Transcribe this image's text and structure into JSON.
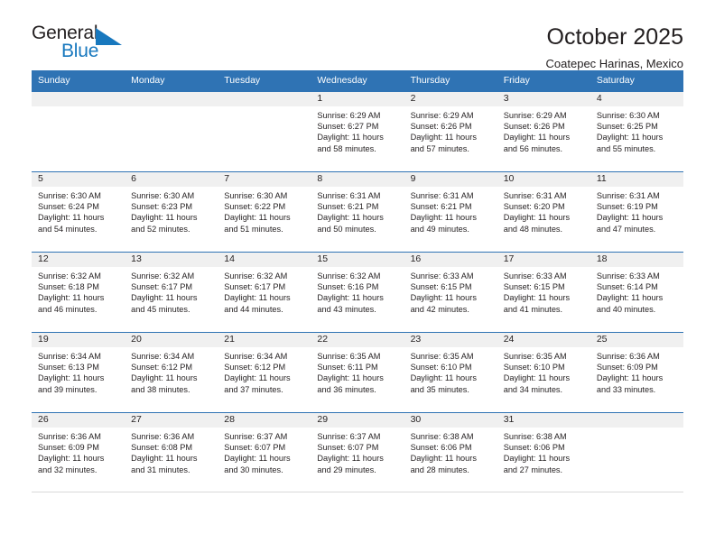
{
  "logo": {
    "word_top": "General",
    "word_bottom": "Blue",
    "accent_color": "#1878be",
    "triangle_icon": "triangle-icon"
  },
  "header": {
    "title": "October 2025",
    "subtitle": "Coatepec Harinas, Mexico"
  },
  "theme": {
    "header_blue": "#2f73b4",
    "day_band_gray": "#f0f0f0",
    "text_color": "#231f20"
  },
  "calendar": {
    "weekday_headers": [
      "Sunday",
      "Monday",
      "Tuesday",
      "Wednesday",
      "Thursday",
      "Friday",
      "Saturday"
    ],
    "labels": {
      "sunrise": "Sunrise:",
      "sunset": "Sunset:",
      "daylight": "Daylight:"
    },
    "weeks": [
      [
        {
          "day": "",
          "sunrise": "",
          "sunset": "",
          "daylight_line1": "",
          "daylight_line2": ""
        },
        {
          "day": "",
          "sunrise": "",
          "sunset": "",
          "daylight_line1": "",
          "daylight_line2": ""
        },
        {
          "day": "",
          "sunrise": "",
          "sunset": "",
          "daylight_line1": "",
          "daylight_line2": ""
        },
        {
          "day": "1",
          "sunrise": "Sunrise: 6:29 AM",
          "sunset": "Sunset: 6:27 PM",
          "daylight_line1": "Daylight: 11 hours",
          "daylight_line2": "and 58 minutes."
        },
        {
          "day": "2",
          "sunrise": "Sunrise: 6:29 AM",
          "sunset": "Sunset: 6:26 PM",
          "daylight_line1": "Daylight: 11 hours",
          "daylight_line2": "and 57 minutes."
        },
        {
          "day": "3",
          "sunrise": "Sunrise: 6:29 AM",
          "sunset": "Sunset: 6:26 PM",
          "daylight_line1": "Daylight: 11 hours",
          "daylight_line2": "and 56 minutes."
        },
        {
          "day": "4",
          "sunrise": "Sunrise: 6:30 AM",
          "sunset": "Sunset: 6:25 PM",
          "daylight_line1": "Daylight: 11 hours",
          "daylight_line2": "and 55 minutes."
        }
      ],
      [
        {
          "day": "5",
          "sunrise": "Sunrise: 6:30 AM",
          "sunset": "Sunset: 6:24 PM",
          "daylight_line1": "Daylight: 11 hours",
          "daylight_line2": "and 54 minutes."
        },
        {
          "day": "6",
          "sunrise": "Sunrise: 6:30 AM",
          "sunset": "Sunset: 6:23 PM",
          "daylight_line1": "Daylight: 11 hours",
          "daylight_line2": "and 52 minutes."
        },
        {
          "day": "7",
          "sunrise": "Sunrise: 6:30 AM",
          "sunset": "Sunset: 6:22 PM",
          "daylight_line1": "Daylight: 11 hours",
          "daylight_line2": "and 51 minutes."
        },
        {
          "day": "8",
          "sunrise": "Sunrise: 6:31 AM",
          "sunset": "Sunset: 6:21 PM",
          "daylight_line1": "Daylight: 11 hours",
          "daylight_line2": "and 50 minutes."
        },
        {
          "day": "9",
          "sunrise": "Sunrise: 6:31 AM",
          "sunset": "Sunset: 6:21 PM",
          "daylight_line1": "Daylight: 11 hours",
          "daylight_line2": "and 49 minutes."
        },
        {
          "day": "10",
          "sunrise": "Sunrise: 6:31 AM",
          "sunset": "Sunset: 6:20 PM",
          "daylight_line1": "Daylight: 11 hours",
          "daylight_line2": "and 48 minutes."
        },
        {
          "day": "11",
          "sunrise": "Sunrise: 6:31 AM",
          "sunset": "Sunset: 6:19 PM",
          "daylight_line1": "Daylight: 11 hours",
          "daylight_line2": "and 47 minutes."
        }
      ],
      [
        {
          "day": "12",
          "sunrise": "Sunrise: 6:32 AM",
          "sunset": "Sunset: 6:18 PM",
          "daylight_line1": "Daylight: 11 hours",
          "daylight_line2": "and 46 minutes."
        },
        {
          "day": "13",
          "sunrise": "Sunrise: 6:32 AM",
          "sunset": "Sunset: 6:17 PM",
          "daylight_line1": "Daylight: 11 hours",
          "daylight_line2": "and 45 minutes."
        },
        {
          "day": "14",
          "sunrise": "Sunrise: 6:32 AM",
          "sunset": "Sunset: 6:17 PM",
          "daylight_line1": "Daylight: 11 hours",
          "daylight_line2": "and 44 minutes."
        },
        {
          "day": "15",
          "sunrise": "Sunrise: 6:32 AM",
          "sunset": "Sunset: 6:16 PM",
          "daylight_line1": "Daylight: 11 hours",
          "daylight_line2": "and 43 minutes."
        },
        {
          "day": "16",
          "sunrise": "Sunrise: 6:33 AM",
          "sunset": "Sunset: 6:15 PM",
          "daylight_line1": "Daylight: 11 hours",
          "daylight_line2": "and 42 minutes."
        },
        {
          "day": "17",
          "sunrise": "Sunrise: 6:33 AM",
          "sunset": "Sunset: 6:15 PM",
          "daylight_line1": "Daylight: 11 hours",
          "daylight_line2": "and 41 minutes."
        },
        {
          "day": "18",
          "sunrise": "Sunrise: 6:33 AM",
          "sunset": "Sunset: 6:14 PM",
          "daylight_line1": "Daylight: 11 hours",
          "daylight_line2": "and 40 minutes."
        }
      ],
      [
        {
          "day": "19",
          "sunrise": "Sunrise: 6:34 AM",
          "sunset": "Sunset: 6:13 PM",
          "daylight_line1": "Daylight: 11 hours",
          "daylight_line2": "and 39 minutes."
        },
        {
          "day": "20",
          "sunrise": "Sunrise: 6:34 AM",
          "sunset": "Sunset: 6:12 PM",
          "daylight_line1": "Daylight: 11 hours",
          "daylight_line2": "and 38 minutes."
        },
        {
          "day": "21",
          "sunrise": "Sunrise: 6:34 AM",
          "sunset": "Sunset: 6:12 PM",
          "daylight_line1": "Daylight: 11 hours",
          "daylight_line2": "and 37 minutes."
        },
        {
          "day": "22",
          "sunrise": "Sunrise: 6:35 AM",
          "sunset": "Sunset: 6:11 PM",
          "daylight_line1": "Daylight: 11 hours",
          "daylight_line2": "and 36 minutes."
        },
        {
          "day": "23",
          "sunrise": "Sunrise: 6:35 AM",
          "sunset": "Sunset: 6:10 PM",
          "daylight_line1": "Daylight: 11 hours",
          "daylight_line2": "and 35 minutes."
        },
        {
          "day": "24",
          "sunrise": "Sunrise: 6:35 AM",
          "sunset": "Sunset: 6:10 PM",
          "daylight_line1": "Daylight: 11 hours",
          "daylight_line2": "and 34 minutes."
        },
        {
          "day": "25",
          "sunrise": "Sunrise: 6:36 AM",
          "sunset": "Sunset: 6:09 PM",
          "daylight_line1": "Daylight: 11 hours",
          "daylight_line2": "and 33 minutes."
        }
      ],
      [
        {
          "day": "26",
          "sunrise": "Sunrise: 6:36 AM",
          "sunset": "Sunset: 6:09 PM",
          "daylight_line1": "Daylight: 11 hours",
          "daylight_line2": "and 32 minutes."
        },
        {
          "day": "27",
          "sunrise": "Sunrise: 6:36 AM",
          "sunset": "Sunset: 6:08 PM",
          "daylight_line1": "Daylight: 11 hours",
          "daylight_line2": "and 31 minutes."
        },
        {
          "day": "28",
          "sunrise": "Sunrise: 6:37 AM",
          "sunset": "Sunset: 6:07 PM",
          "daylight_line1": "Daylight: 11 hours",
          "daylight_line2": "and 30 minutes."
        },
        {
          "day": "29",
          "sunrise": "Sunrise: 6:37 AM",
          "sunset": "Sunset: 6:07 PM",
          "daylight_line1": "Daylight: 11 hours",
          "daylight_line2": "and 29 minutes."
        },
        {
          "day": "30",
          "sunrise": "Sunrise: 6:38 AM",
          "sunset": "Sunset: 6:06 PM",
          "daylight_line1": "Daylight: 11 hours",
          "daylight_line2": "and 28 minutes."
        },
        {
          "day": "31",
          "sunrise": "Sunrise: 6:38 AM",
          "sunset": "Sunset: 6:06 PM",
          "daylight_line1": "Daylight: 11 hours",
          "daylight_line2": "and 27 minutes."
        },
        {
          "day": "",
          "sunrise": "",
          "sunset": "",
          "daylight_line1": "",
          "daylight_line2": ""
        }
      ]
    ]
  }
}
